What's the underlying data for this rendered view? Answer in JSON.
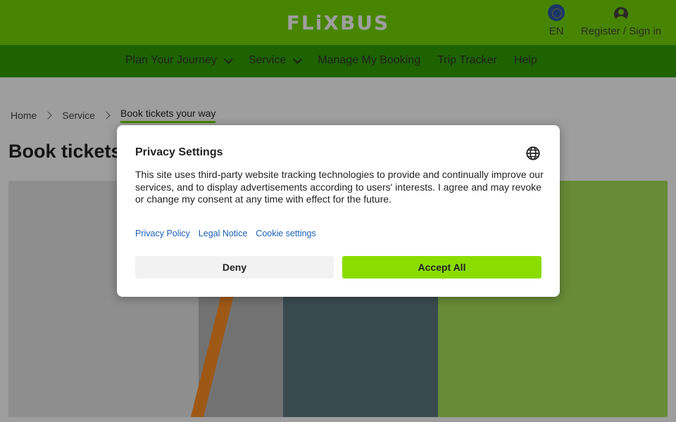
{
  "header": {
    "logo": "FLiXBUS",
    "language": "EN",
    "account": "Register / Sign in"
  },
  "nav": {
    "items": [
      {
        "label": "Plan Your Journey",
        "has_dropdown": true
      },
      {
        "label": "Service",
        "has_dropdown": true
      },
      {
        "label": "Manage My Booking",
        "has_dropdown": false
      },
      {
        "label": "Trip Tracker",
        "has_dropdown": false
      },
      {
        "label": "Help",
        "has_dropdown": false
      }
    ]
  },
  "breadcrumb": {
    "items": [
      "Home",
      "Service",
      "Book tickets your way"
    ]
  },
  "page": {
    "title": "Book tickets"
  },
  "modal": {
    "title": "Privacy Settings",
    "text": "This site uses third-party website tracking technologies to provide and continually improve our services, and to display advertisements according to users' interests. I agree and may revoke or change my consent at any time with effect for the future.",
    "links": {
      "privacy_policy": "Privacy Policy",
      "legal_notice": "Legal Notice",
      "cookie_settings": "Cookie settings"
    },
    "deny_label": "Deny",
    "accept_label": "Accept All"
  },
  "colors": {
    "brand_green": "#73d700",
    "nav_green": "#31a100",
    "accept_button": "#8bdc00",
    "link_blue": "#1a5fb4"
  },
  "icons": [
    "globe-icon",
    "user-icon",
    "chevron-down-icon",
    "chevron-right-icon",
    "language-icon"
  ]
}
